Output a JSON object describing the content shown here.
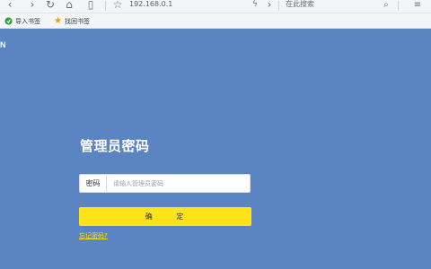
{
  "browser": {
    "url": "192.168.0.1",
    "search_placeholder": "在此搜索",
    "bookmarks": [
      {
        "label": "导入书签",
        "icon": "import-bookmark-icon"
      },
      {
        "label": "找回书签",
        "icon": "star-icon"
      }
    ]
  },
  "page": {
    "brand_partial": "N",
    "title": "管理员密码",
    "password_label": "密码",
    "password_placeholder": "请输入管理员密码",
    "confirm_label": "确 定",
    "forgot_label": "忘记密码?"
  },
  "colors": {
    "background": "#5b84c2",
    "accent": "#ffe31a"
  }
}
